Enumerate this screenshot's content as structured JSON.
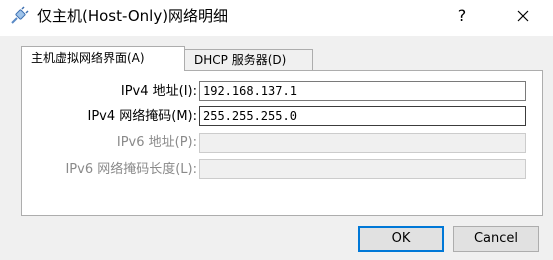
{
  "window": {
    "title": "仅主机(Host-Only)网络明细",
    "help_label": "?",
    "close_icon": "close-icon",
    "app_icon": "network-plug-icon"
  },
  "tabs": [
    {
      "label": "主机虚拟网络界面(A)",
      "selected": true
    },
    {
      "label": "DHCP 服务器(D)",
      "selected": false
    }
  ],
  "form": {
    "ipv4_address_label": "IPv4 地址(I):",
    "ipv4_address_value": "192.168.137.1",
    "ipv4_mask_label": "IPv4 网络掩码(M):",
    "ipv4_mask_value": "255.255.255.0",
    "ipv6_address_label": "IPv6 地址(P):",
    "ipv6_address_value": "",
    "ipv6_prefix_label": "IPv6 网络掩码长度(L):",
    "ipv6_prefix_value": ""
  },
  "buttons": {
    "ok_label": "OK",
    "cancel_label": "Cancel"
  },
  "colors": {
    "accent": "#0078d7",
    "dialog_bg": "#f0f0f0",
    "disabled_text": "#8a8a8a"
  }
}
